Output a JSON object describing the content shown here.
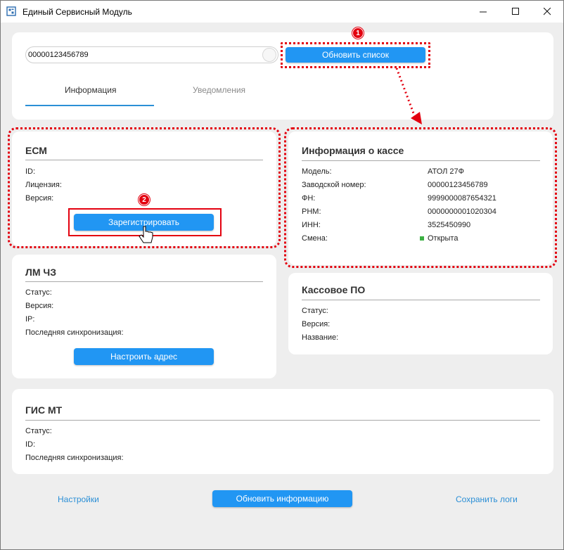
{
  "window": {
    "title": "Единый Сервисный Модуль",
    "icon": "app-icon",
    "controls": [
      "minimize-icon",
      "maximize-icon",
      "close-icon"
    ]
  },
  "top": {
    "search_value": "00000123456789",
    "refresh_button": "Обновить список",
    "tabs": [
      {
        "label": "Информация",
        "active": true
      },
      {
        "label": "Уведомления",
        "active": false
      }
    ]
  },
  "ecm": {
    "title": "ЕСМ",
    "fields": [
      {
        "label": "ID:",
        "value": ""
      },
      {
        "label": "Лицензия:",
        "value": ""
      },
      {
        "label": "Версия:",
        "value": ""
      }
    ],
    "register_button": "Зарегистрировать"
  },
  "kassa": {
    "title": "Информация о кассе",
    "fields": [
      {
        "label": "Модель:",
        "value": "АТОЛ 27Ф"
      },
      {
        "label": "Заводской номер:",
        "value": "00000123456789"
      },
      {
        "label": "ФН:",
        "value": "9999000087654321"
      },
      {
        "label": "РНМ:",
        "value": "0000000001020304"
      },
      {
        "label": "ИНН:",
        "value": "3525450990"
      },
      {
        "label": "Смена:",
        "value": "Открыта"
      }
    ],
    "shift_status_color": "#3cb043"
  },
  "lm": {
    "title": "ЛМ ЧЗ",
    "fields": [
      {
        "label": "Статус:",
        "value": ""
      },
      {
        "label": "Версия:",
        "value": ""
      },
      {
        "label": "IP:",
        "value": ""
      },
      {
        "label": "Последняя синхронизация:",
        "value": ""
      }
    ],
    "configure_button": "Настроить адрес"
  },
  "po": {
    "title": "Кассовое ПО",
    "fields": [
      {
        "label": "Статус:",
        "value": ""
      },
      {
        "label": "Версия:",
        "value": ""
      },
      {
        "label": "Название:",
        "value": ""
      }
    ]
  },
  "gis": {
    "title": "ГИС МТ",
    "fields": [
      {
        "label": "Статус:",
        "value": ""
      },
      {
        "label": "ID:",
        "value": ""
      },
      {
        "label": "Последняя синхронизация:",
        "value": ""
      }
    ]
  },
  "footer": {
    "settings_link": "Настройки",
    "update_button": "Обновить информацию",
    "save_logs_link": "Сохранить логи"
  },
  "annotations": {
    "badge_1": "1",
    "badge_2": "2",
    "accent_color": "#e3000f"
  },
  "colors": {
    "primary_button": "#2196f3",
    "link": "#2b8fd6",
    "background": "#eeeeee"
  }
}
